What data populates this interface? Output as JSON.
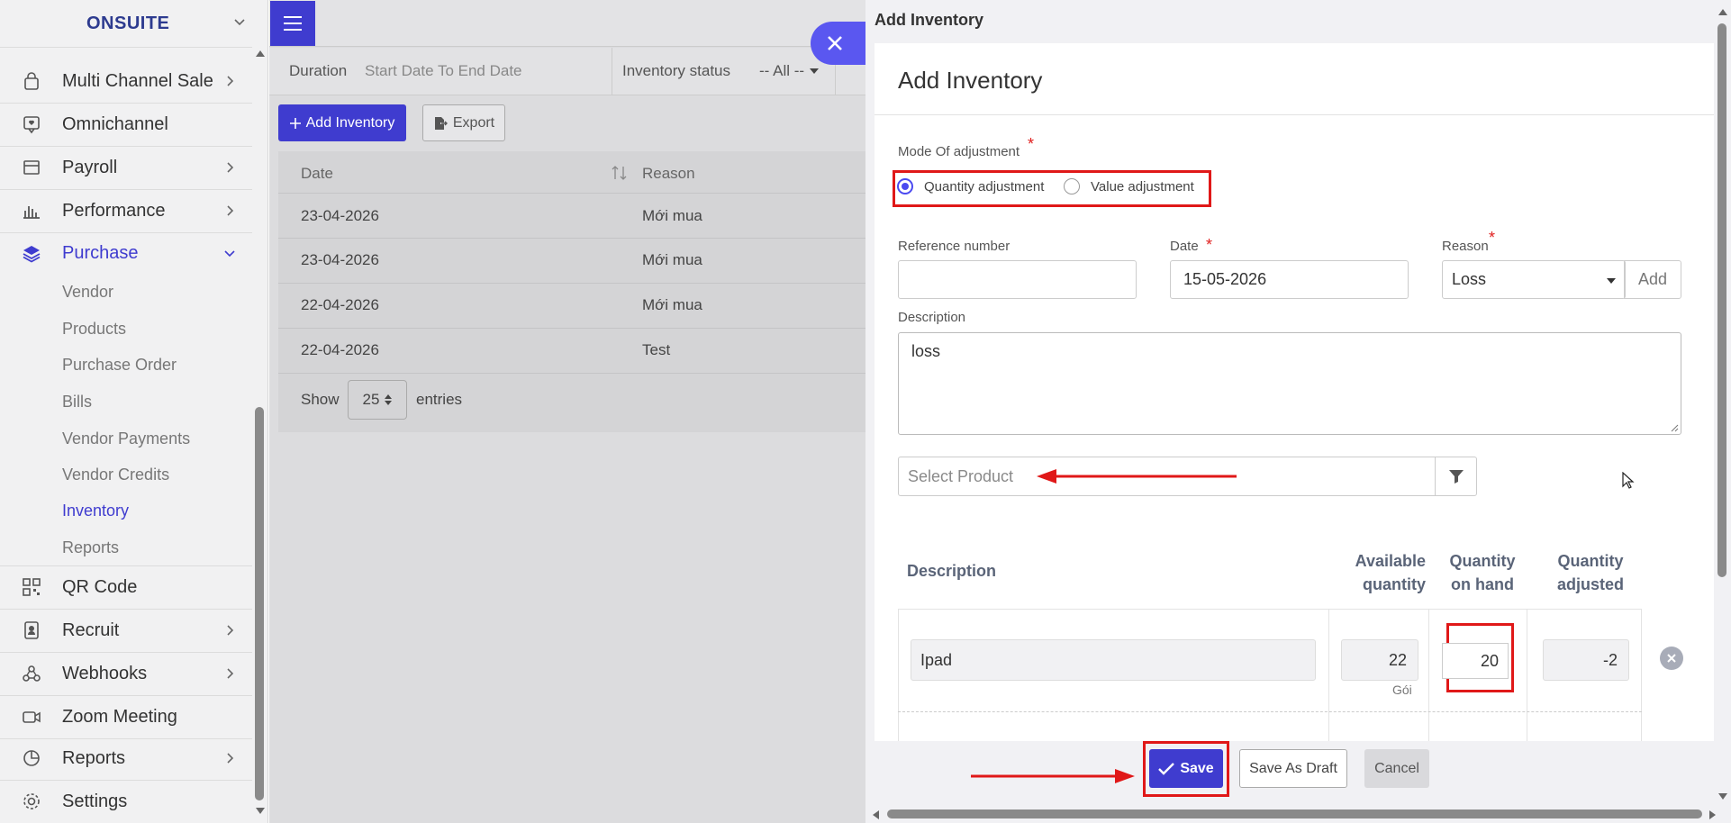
{
  "sidebar": {
    "brand": "ONSUITE",
    "items": [
      {
        "label": "Multi Channel Sale",
        "icon": "bag-icon"
      },
      {
        "label": "Omnichannel",
        "icon": "chat-icon"
      },
      {
        "label": "Payroll",
        "icon": "wallet-icon"
      },
      {
        "label": "Performance",
        "icon": "bar-chart-icon"
      },
      {
        "label": "Purchase",
        "icon": "layers-icon"
      },
      {
        "label": "QR Code",
        "icon": "qr-code-icon"
      },
      {
        "label": "Recruit",
        "icon": "id-card-icon"
      },
      {
        "label": "Webhooks",
        "icon": "webhook-icon"
      },
      {
        "label": "Zoom Meeting",
        "icon": "video-icon"
      },
      {
        "label": "Reports",
        "icon": "pie-chart-icon"
      },
      {
        "label": "Settings",
        "icon": "gear-icon"
      }
    ],
    "purchase_sub": [
      "Vendor",
      "Products",
      "Purchase Order",
      "Bills",
      "Vendor Payments",
      "Vendor Credits",
      "Inventory",
      "Reports"
    ]
  },
  "main": {
    "filters": {
      "duration_label": "Duration",
      "duration_value": "Start Date To End Date",
      "status_label": "Inventory status",
      "status_value": "-- All --"
    },
    "add_button": "Add Inventory",
    "export_button": "Export",
    "table": {
      "headers": [
        "Date",
        "Reason"
      ],
      "rows": [
        {
          "date": "23-04-2026",
          "reason": "Mới mua"
        },
        {
          "date": "23-04-2026",
          "reason": "Mới mua"
        },
        {
          "date": "22-04-2026",
          "reason": "Mới mua"
        },
        {
          "date": "22-04-2026",
          "reason": "Test"
        }
      ],
      "show_label": "Show",
      "page_size": "25",
      "entries_label": "entries"
    }
  },
  "panel": {
    "title": "Add Inventory",
    "card_title": "Add Inventory",
    "mode_label": "Mode Of adjustment",
    "mode_options": [
      "Quantity adjustment",
      "Value adjustment"
    ],
    "reference_label": "Reference number",
    "reference_value": "",
    "date_label": "Date",
    "date_value": "15-05-2026",
    "reason_label": "Reason",
    "reason_value": "Loss",
    "reason_add": "Add",
    "description_label": "Description",
    "description_value": "loss",
    "product_placeholder": "Select Product",
    "items_headers": {
      "description": "Description",
      "available_1": "Available",
      "available_2": "quantity",
      "onhand_1": "Quantity",
      "onhand_2": "on hand",
      "adjusted_1": "Quantity",
      "adjusted_2": "adjusted"
    },
    "item": {
      "name": "Ipad",
      "available": "22",
      "unit": "Gói",
      "on_hand": "20",
      "adjusted": "-2"
    },
    "save": "Save",
    "save_draft": "Save As Draft",
    "cancel": "Cancel"
  },
  "colors": {
    "accent": "#3f3ccf",
    "annotation": "#e01818"
  }
}
